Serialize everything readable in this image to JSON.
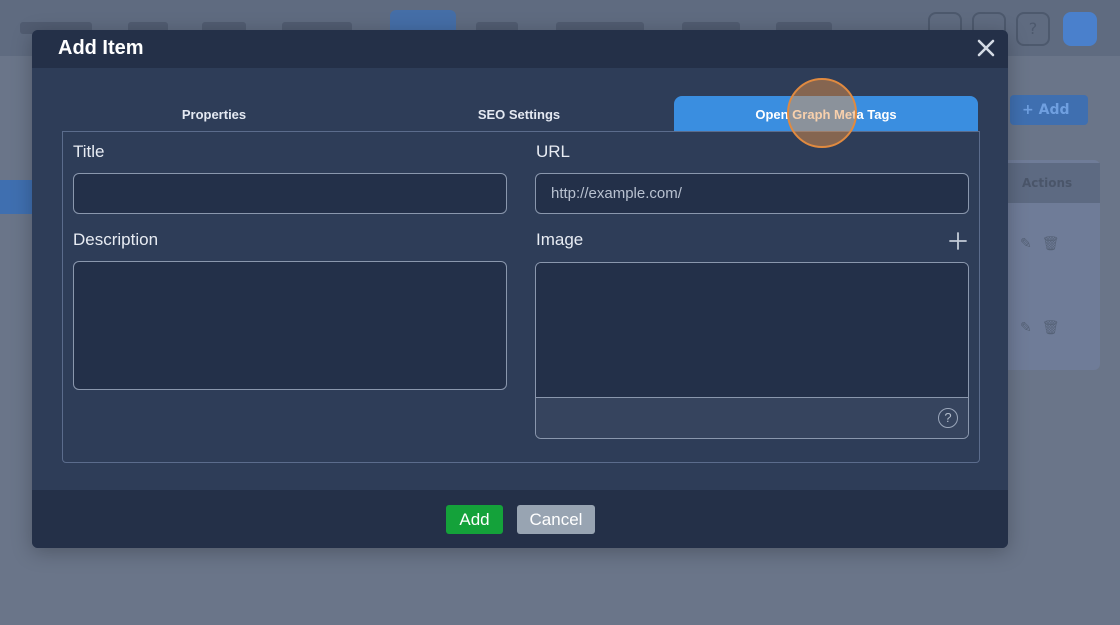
{
  "modal": {
    "title": "Add Item",
    "tabs": [
      {
        "label": "Properties",
        "active": false
      },
      {
        "label": "SEO Settings",
        "active": false
      },
      {
        "label": "Open Graph Meta Tags",
        "active": true
      }
    ],
    "fields": {
      "title": {
        "label": "Title",
        "value": ""
      },
      "url": {
        "label": "URL",
        "placeholder": "http://example.com/"
      },
      "description": {
        "label": "Description",
        "value": ""
      },
      "image": {
        "label": "Image"
      }
    },
    "footer": {
      "add_label": "Add",
      "cancel_label": "Cancel"
    }
  },
  "background": {
    "add_label": "+ Add",
    "actions_header": "Actions",
    "help_glyph": "?"
  },
  "icons": {
    "close": "close-icon",
    "plus": "plus-icon",
    "help": "question-circle-icon"
  },
  "colors": {
    "accent": "#3a8ee0",
    "add_button": "#14a23a",
    "cancel_button": "#98a4b2",
    "modal_bg": "#2e3d58",
    "header_bg": "#243048",
    "overlay_bg": "#6a7589",
    "click_marker": "#e08a40"
  }
}
